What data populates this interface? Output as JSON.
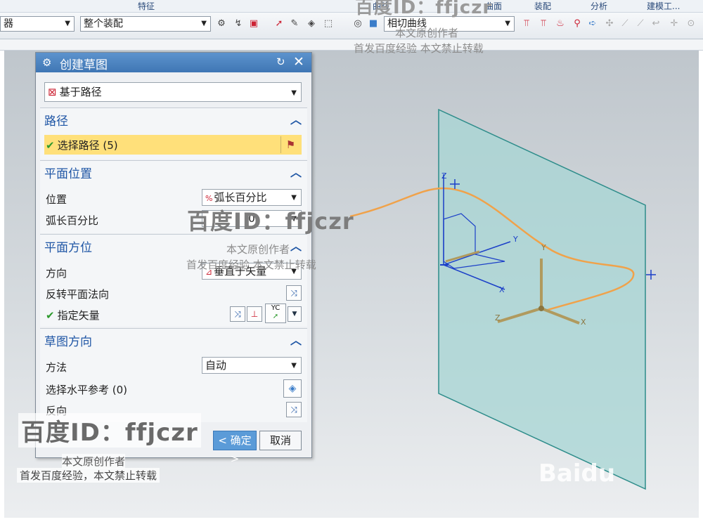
{
  "ribbon": {
    "tabs": [
      "特征",
      "曲线",
      "曲面",
      "装配",
      "分析",
      "建模工..."
    ]
  },
  "toolbar": {
    "left_combo": "器",
    "assembly_combo": "整个装配",
    "curve_rule_combo": "相切曲线"
  },
  "dialog": {
    "title": "创建草图",
    "type_dropdown": "基于路径",
    "sections": {
      "path": {
        "header": "路径",
        "select_path": "选择路径 (5)"
      },
      "plane_location": {
        "header": "平面位置",
        "location_label": "位置",
        "location_value": "弧长百分比",
        "arc_percent_label": "弧长百分比",
        "arc_percent_value": "0"
      },
      "plane_orientation": {
        "header": "平面方位",
        "direction_label": "方向",
        "direction_value": "垂直于矢量",
        "reverse_normal_label": "反转平面法向",
        "specify_vector_label": "指定矢量",
        "vector_btn_text": "YC"
      },
      "sketch_orientation": {
        "header": "草图方向",
        "method_label": "方法",
        "method_value": "自动",
        "select_horizontal_ref_label": "选择水平参考 (0)",
        "reverse_label": "反向"
      }
    },
    "ok_button": "< 确定 >",
    "cancel_button": "取消"
  },
  "viewport": {
    "csys_labels": {
      "z": "Z",
      "y": "Y",
      "x": "X"
    }
  },
  "watermarks": {
    "baidu_id": "百度ID：ffjczr",
    "author_line": "本文原创作者",
    "notice_line": "首发百度经验  本文禁止转载",
    "notice_line_2": "首发百度经验，本文禁止转载",
    "baidu_logo": "Baidu"
  },
  "colors": {
    "title_bar": "#4a84c2",
    "section_header": "#1f56a5",
    "highlight_row": "#ffe07a",
    "plane_fill": "#a8d8d6",
    "path_curve": "#f0a24a",
    "ok_button": "#5b9bd8"
  }
}
